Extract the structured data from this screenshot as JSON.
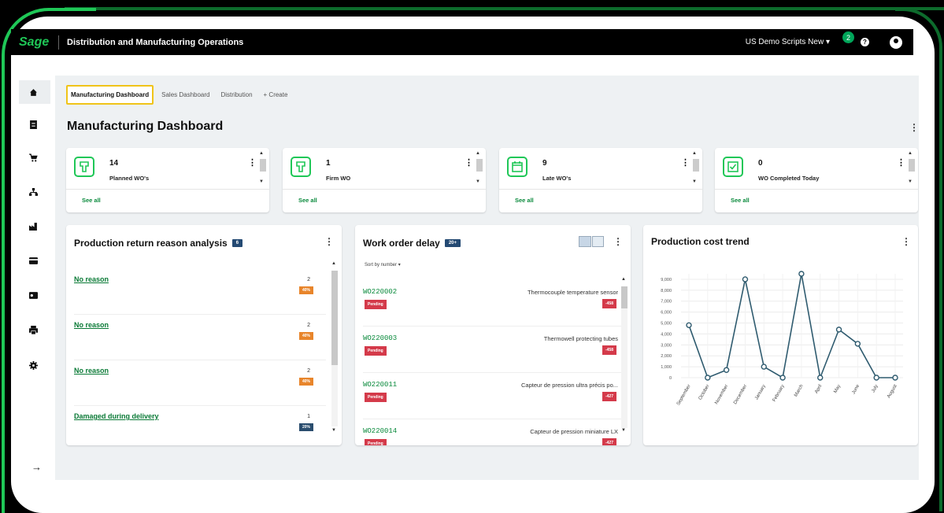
{
  "topbar": {
    "logo": "Sage",
    "app_title": "Distribution and Manufacturing Operations",
    "company": "US Demo Scripts New",
    "notif_count": "2",
    "help": "?"
  },
  "sidebar": {
    "icons": [
      "home-icon",
      "document-icon",
      "cart-icon",
      "hierarchy-icon",
      "factory-icon",
      "card-icon",
      "id-card-icon",
      "printer-icon",
      "gear-icon"
    ],
    "collapse": "→"
  },
  "tabs": [
    {
      "label": "Manufacturing Dashboard",
      "active": true
    },
    {
      "label": "Sales Dashboard",
      "active": false
    },
    {
      "label": "Distribution",
      "active": false
    },
    {
      "label": "+ Create",
      "active": false
    }
  ],
  "page": {
    "title": "Manufacturing Dashboard"
  },
  "stats": [
    {
      "value": "14",
      "label": "Planned WO's",
      "see_all": "See all",
      "icon": "wrench-icon"
    },
    {
      "value": "1",
      "label": "Firm WO",
      "see_all": "See all",
      "icon": "wrench-icon"
    },
    {
      "value": "9",
      "label": "Late WO's",
      "see_all": "See all",
      "icon": "calendar-icon"
    },
    {
      "value": "0",
      "label": "WO Completed Today",
      "see_all": "See all",
      "icon": "checkbox-icon"
    }
  ],
  "return_reasons": {
    "title": "Production return reason analysis",
    "count": "6",
    "rows": [
      {
        "reason": "No reason",
        "count": "2",
        "pct": "40%",
        "color": "#e8852b"
      },
      {
        "reason": "No reason",
        "count": "2",
        "pct": "40%",
        "color": "#e8852b"
      },
      {
        "reason": "No reason",
        "count": "2",
        "pct": "40%",
        "color": "#e8852b"
      },
      {
        "reason": "Damaged during delivery",
        "count": "1",
        "pct": "20%",
        "color": "#2a4d6e"
      }
    ]
  },
  "work_order_delay": {
    "title": "Work order delay",
    "count": "20+",
    "sort_label": "Sort by number",
    "rows": [
      {
        "id": "WO220002",
        "status": "Pending",
        "desc": "Thermocouple temperature sensor",
        "delay": "-458"
      },
      {
        "id": "WO220003",
        "status": "Pending",
        "desc": "Thermowell protecting tubes",
        "delay": "-458"
      },
      {
        "id": "WO220011",
        "status": "Pending",
        "desc": "Capteur de pression ultra précis po...",
        "delay": "-427"
      },
      {
        "id": "WO220014",
        "status": "Pending",
        "desc": "Capteur de pression miniature LX",
        "delay": "-427"
      }
    ]
  },
  "cost_trend": {
    "title": "Production cost trend"
  },
  "chart_data": {
    "type": "line",
    "title": "Production cost trend",
    "categories": [
      "September",
      "October",
      "November",
      "December",
      "January",
      "February",
      "March",
      "April",
      "May",
      "June",
      "July",
      "August"
    ],
    "values": [
      4800,
      0,
      700,
      9000,
      1000,
      0,
      9500,
      0,
      4400,
      3100,
      0,
      0
    ],
    "ylim": [
      0,
      9000
    ],
    "yticks": [
      "0",
      "1,000",
      "2,000",
      "3,000",
      "4,000",
      "5,000",
      "6,000",
      "7,000",
      "8,000",
      "9,000"
    ],
    "grid": true,
    "line_color": "#2f5b6f"
  }
}
